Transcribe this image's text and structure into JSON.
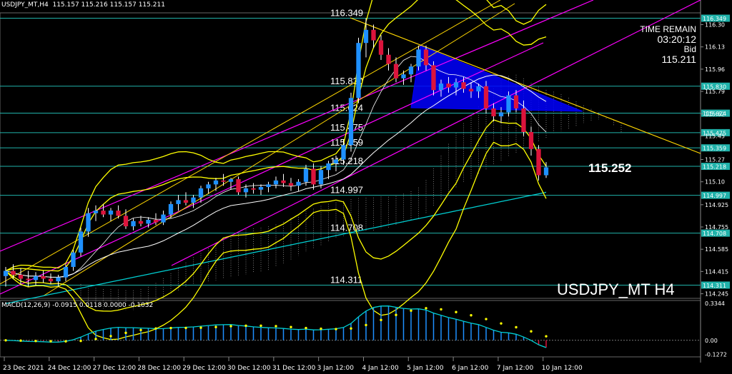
{
  "header": {
    "symbol": "USDJPY_MT,H4",
    "ohlc": "115.157 115.216 115.157 115.211"
  },
  "info_panel": {
    "time_label": "TIME REMAIN",
    "time_value": "03:20:12",
    "bid_label": "Bid",
    "bid_value": "115.211"
  },
  "watermark": "USDJPY_MT H4",
  "current_price_label": "115.252",
  "macd_header": "MACD(12,26,9) -0.0915 0.0118 0.0000 -0.1032",
  "colors": {
    "bull": "#1e90ff",
    "bear": "#dc143c",
    "level": "#20b2aa",
    "bollinger": "#ffff00",
    "channel": "#ff00ff",
    "trendline": "#ffd700",
    "triangle": "#0000ff",
    "ma_long": "#00ced1",
    "macd_line": "#00ced1",
    "macd_signal": "#ffff00"
  },
  "chart_data": {
    "type": "candlestick",
    "symbol": "USDJPY_MT",
    "timeframe": "H4",
    "ylim": [
      114.21,
      116.39
    ],
    "y_ticks": [
      116.3,
      116.13,
      115.96,
      115.79,
      115.62,
      115.45,
      115.27,
      115.1,
      114.925,
      114.755,
      114.585,
      114.415,
      114.245
    ],
    "x_labels": [
      "23 Dec 2021",
      "24 Dec 12:00",
      "27 Dec 12:00",
      "28 Dec 12:00",
      "29 Dec 12:00",
      "30 Dec 12:00",
      "31 Dec 12:00",
      "3 Jan 12:00",
      "4 Jan 12:00",
      "5 Jan 12:00",
      "6 Jan 12:00",
      "7 Jan 12:00",
      "10 Jan 12:00"
    ],
    "price_levels": [
      116.349,
      115.83,
      115.624,
      115.475,
      115.359,
      115.218,
      114.997,
      114.708,
      114.311
    ],
    "level_labels": [
      "116.349",
      "115.830",
      "115.624",
      "115.475",
      "115.359",
      "115.218",
      "114.997",
      "114.708",
      "114.311"
    ],
    "current_price": 115.252,
    "candles": [
      {
        "o": 114.38,
        "h": 114.45,
        "l": 114.3,
        "c": 114.42
      },
      {
        "o": 114.42,
        "h": 114.47,
        "l": 114.36,
        "c": 114.39
      },
      {
        "o": 114.39,
        "h": 114.44,
        "l": 114.32,
        "c": 114.36
      },
      {
        "o": 114.36,
        "h": 114.42,
        "l": 114.3,
        "c": 114.35
      },
      {
        "o": 114.35,
        "h": 114.41,
        "l": 114.31,
        "c": 114.38
      },
      {
        "o": 114.38,
        "h": 114.42,
        "l": 114.33,
        "c": 114.36
      },
      {
        "o": 114.36,
        "h": 114.4,
        "l": 114.32,
        "c": 114.34
      },
      {
        "o": 114.34,
        "h": 114.39,
        "l": 114.3,
        "c": 114.37
      },
      {
        "o": 114.37,
        "h": 114.47,
        "l": 114.34,
        "c": 114.45
      },
      {
        "o": 114.45,
        "h": 114.58,
        "l": 114.42,
        "c": 114.56
      },
      {
        "o": 114.56,
        "h": 114.75,
        "l": 114.53,
        "c": 114.72
      },
      {
        "o": 114.72,
        "h": 114.9,
        "l": 114.68,
        "c": 114.86
      },
      {
        "o": 114.86,
        "h": 114.92,
        "l": 114.8,
        "c": 114.88
      },
      {
        "o": 114.88,
        "h": 114.93,
        "l": 114.83,
        "c": 114.85
      },
      {
        "o": 114.85,
        "h": 114.9,
        "l": 114.8,
        "c": 114.88
      },
      {
        "o": 114.88,
        "h": 114.92,
        "l": 114.82,
        "c": 114.84
      },
      {
        "o": 114.84,
        "h": 114.89,
        "l": 114.74,
        "c": 114.76
      },
      {
        "o": 114.76,
        "h": 114.82,
        "l": 114.73,
        "c": 114.8
      },
      {
        "o": 114.8,
        "h": 114.84,
        "l": 114.76,
        "c": 114.78
      },
      {
        "o": 114.78,
        "h": 114.83,
        "l": 114.75,
        "c": 114.81
      },
      {
        "o": 114.81,
        "h": 114.86,
        "l": 114.77,
        "c": 114.79
      },
      {
        "o": 114.79,
        "h": 114.88,
        "l": 114.77,
        "c": 114.85
      },
      {
        "o": 114.85,
        "h": 114.95,
        "l": 114.82,
        "c": 114.93
      },
      {
        "o": 114.93,
        "h": 115.0,
        "l": 114.88,
        "c": 114.96
      },
      {
        "o": 114.96,
        "h": 115.02,
        "l": 114.92,
        "c": 114.94
      },
      {
        "o": 114.94,
        "h": 115.0,
        "l": 114.9,
        "c": 114.98
      },
      {
        "o": 114.98,
        "h": 115.07,
        "l": 114.94,
        "c": 115.05
      },
      {
        "o": 115.05,
        "h": 115.1,
        "l": 115.01,
        "c": 115.08
      },
      {
        "o": 115.08,
        "h": 115.13,
        "l": 115.03,
        "c": 115.11
      },
      {
        "o": 115.11,
        "h": 115.16,
        "l": 115.07,
        "c": 115.1
      },
      {
        "o": 115.1,
        "h": 115.13,
        "l": 115.04,
        "c": 115.12
      },
      {
        "o": 115.12,
        "h": 115.14,
        "l": 115.0,
        "c": 115.02
      },
      {
        "o": 115.02,
        "h": 115.08,
        "l": 114.98,
        "c": 115.05
      },
      {
        "o": 115.05,
        "h": 115.09,
        "l": 115.01,
        "c": 115.04
      },
      {
        "o": 115.04,
        "h": 115.08,
        "l": 115.0,
        "c": 115.06
      },
      {
        "o": 115.06,
        "h": 115.1,
        "l": 115.02,
        "c": 115.08
      },
      {
        "o": 115.08,
        "h": 115.14,
        "l": 115.05,
        "c": 115.11
      },
      {
        "o": 115.11,
        "h": 115.16,
        "l": 115.06,
        "c": 115.09
      },
      {
        "o": 115.09,
        "h": 115.13,
        "l": 115.03,
        "c": 115.07
      },
      {
        "o": 115.07,
        "h": 115.12,
        "l": 115.03,
        "c": 115.1
      },
      {
        "o": 115.1,
        "h": 115.23,
        "l": 115.07,
        "c": 115.2
      },
      {
        "o": 115.2,
        "h": 115.24,
        "l": 115.04,
        "c": 115.08
      },
      {
        "o": 115.08,
        "h": 115.22,
        "l": 115.05,
        "c": 115.19
      },
      {
        "o": 115.19,
        "h": 115.26,
        "l": 115.12,
        "c": 115.24
      },
      {
        "o": 115.24,
        "h": 115.3,
        "l": 115.18,
        "c": 115.27
      },
      {
        "o": 115.27,
        "h": 115.42,
        "l": 115.23,
        "c": 115.38
      },
      {
        "o": 115.38,
        "h": 115.78,
        "l": 115.33,
        "c": 115.74
      },
      {
        "o": 115.74,
        "h": 116.2,
        "l": 115.7,
        "c": 116.16
      },
      {
        "o": 116.16,
        "h": 116.349,
        "l": 116.05,
        "c": 116.26
      },
      {
        "o": 116.26,
        "h": 116.3,
        "l": 116.12,
        "c": 116.18
      },
      {
        "o": 116.18,
        "h": 116.22,
        "l": 116.03,
        "c": 116.07
      },
      {
        "o": 116.07,
        "h": 116.12,
        "l": 115.95,
        "c": 116.0
      },
      {
        "o": 116.0,
        "h": 116.05,
        "l": 115.86,
        "c": 115.89
      },
      {
        "o": 115.89,
        "h": 115.95,
        "l": 115.84,
        "c": 115.92
      },
      {
        "o": 115.92,
        "h": 116.0,
        "l": 115.86,
        "c": 115.98
      },
      {
        "o": 115.98,
        "h": 116.14,
        "l": 115.95,
        "c": 116.11
      },
      {
        "o": 116.11,
        "h": 116.14,
        "l": 115.95,
        "c": 115.99
      },
      {
        "o": 115.99,
        "h": 116.02,
        "l": 115.76,
        "c": 115.8
      },
      {
        "o": 115.8,
        "h": 115.88,
        "l": 115.75,
        "c": 115.85
      },
      {
        "o": 115.85,
        "h": 115.9,
        "l": 115.78,
        "c": 115.82
      },
      {
        "o": 115.82,
        "h": 115.89,
        "l": 115.76,
        "c": 115.86
      },
      {
        "o": 115.86,
        "h": 115.9,
        "l": 115.78,
        "c": 115.81
      },
      {
        "o": 115.81,
        "h": 115.86,
        "l": 115.74,
        "c": 115.79
      },
      {
        "o": 115.79,
        "h": 115.85,
        "l": 115.74,
        "c": 115.83
      },
      {
        "o": 115.83,
        "h": 115.87,
        "l": 115.62,
        "c": 115.66
      },
      {
        "o": 115.66,
        "h": 115.7,
        "l": 115.56,
        "c": 115.6
      },
      {
        "o": 115.6,
        "h": 115.67,
        "l": 115.55,
        "c": 115.63
      },
      {
        "o": 115.63,
        "h": 115.79,
        "l": 115.6,
        "c": 115.76
      },
      {
        "o": 115.76,
        "h": 115.8,
        "l": 115.63,
        "c": 115.66
      },
      {
        "o": 115.66,
        "h": 115.72,
        "l": 115.45,
        "c": 115.48
      },
      {
        "o": 115.48,
        "h": 115.52,
        "l": 115.3,
        "c": 115.35
      },
      {
        "o": 115.35,
        "h": 115.38,
        "l": 115.11,
        "c": 115.15
      },
      {
        "o": 115.15,
        "h": 115.25,
        "l": 115.13,
        "c": 115.21
      }
    ],
    "macd": {
      "label": "MACD(12,26,9)",
      "main": -0.0915,
      "signal": 0.0118,
      "zero": 0.0,
      "hist": -0.1032,
      "ylim": [
        -0.15,
        0.36
      ],
      "y_ticks": [
        0.3344,
        0.0,
        -0.1272
      ],
      "y_tick_labels": [
        "0.3344",
        "0.00",
        "-0.1272"
      ]
    }
  }
}
